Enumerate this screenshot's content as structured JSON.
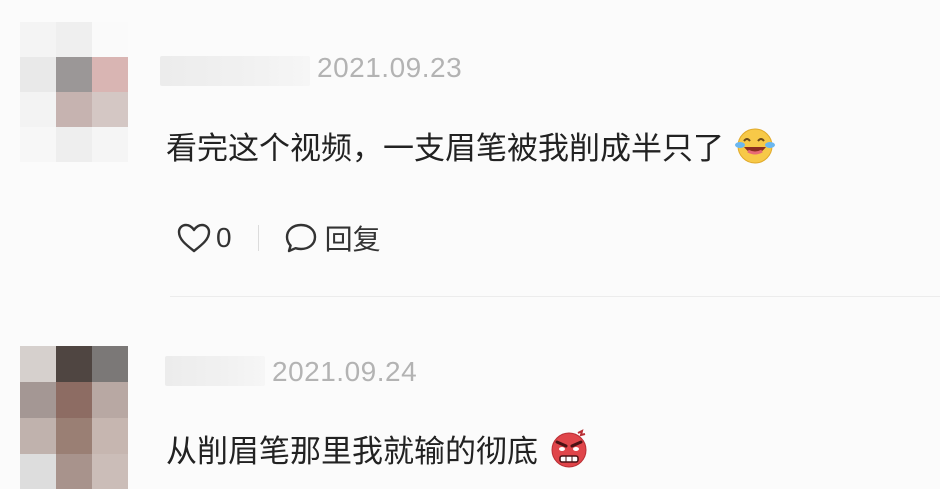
{
  "comments": [
    {
      "timestamp": "2021.09.23",
      "text": "看完这个视频，一支眉笔被我削成半只了",
      "emoji": "laughing-crying-emoji",
      "like_count": "0",
      "reply_label": "回复"
    },
    {
      "timestamp": "2021.09.24",
      "text": "从削眉笔那里我就输的彻底",
      "emoji": "angry-face-emoji"
    }
  ],
  "colors": {
    "timestamp": "#b3b3b3",
    "text": "#222222",
    "divider": "#ececec"
  },
  "avatar_pixels": {
    "first": [
      "#f4f4f4",
      "#efefef",
      "#fafafa",
      "#e9e9e9",
      "#9b9797",
      "#d9b5b3",
      "#f3f3f3",
      "#c6b3b0",
      "#d4c7c4",
      "#f7f7f7",
      "#eeeeee",
      "#f5f5f5"
    ],
    "second": [
      "#d6d0cd",
      "#4f4541",
      "#7b7877",
      "#a49794",
      "#8d6c63",
      "#b8a8a3",
      "#c0b2ad",
      "#9a7f74",
      "#c6b6b0",
      "#dddddd",
      "#a8938c",
      "#cbbdb8"
    ]
  }
}
